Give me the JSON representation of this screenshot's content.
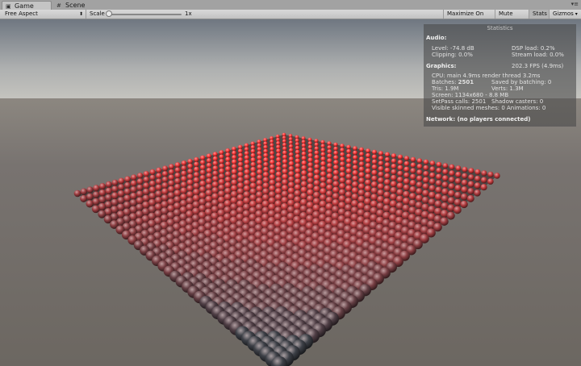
{
  "tabs": [
    {
      "label": "Game",
      "icon": "game-icon"
    },
    {
      "label": "Scene",
      "icon": "scene-icon"
    }
  ],
  "window_menu": "▾≡",
  "toolbar": {
    "aspect": "Free Aspect",
    "scale_label": "Scale",
    "scale_value": "1x",
    "scale_level": 0,
    "maximize": "Maximize On Play",
    "mute": "Mute Audio",
    "stats": "Stats",
    "gizmos": "Gizmos"
  },
  "stats": {
    "title": "Statistics",
    "audio_header": "Audio:",
    "level": "Level: -74.8 dB",
    "dsp": "DSP load: 0.2%",
    "clipping": "Clipping: 0.0%",
    "stream": "Stream load: 0.0%",
    "graphics_header": "Graphics:",
    "fps": "202.3 FPS (4.9ms)",
    "cpu": "CPU: main 4.9ms  render thread 3.2ms",
    "batches_label": "Batches: ",
    "batches_value": "2501",
    "saved": "Saved by batching: 0",
    "tris": "Tris: 1.9M",
    "verts": "Verts: 1.3M",
    "screen": "Screen: 1134x680 - 8.8 MB",
    "setpass": "SetPass calls: 2501",
    "shadow": "Shadow casters: 0",
    "skinned": "Visible skinned meshes: 0  Animations: 0",
    "network": "Network: (no players connected)"
  },
  "colors": {
    "sky_top": "#6f7781",
    "sky_horizon": "#c4c3be",
    "ground": "#746f69",
    "sphere_red": "#ff3a3a",
    "sphere_dark": "#3d4047"
  }
}
